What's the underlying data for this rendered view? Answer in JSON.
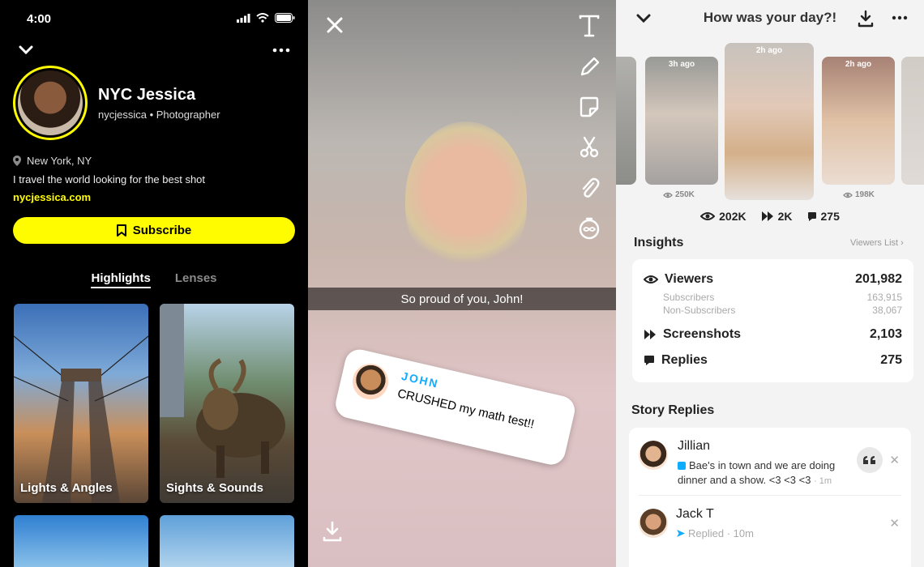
{
  "profile": {
    "time": "4:00",
    "name": "NYC Jessica",
    "handle": "nycjessica • Photographer",
    "location": "New York, NY",
    "bio": "I travel the world looking for the best shot",
    "link": "nycjessica.com",
    "subscribe_label": "Subscribe",
    "tabs": [
      "Highlights",
      "Lenses"
    ],
    "tiles": [
      "Lights & Angles",
      "Sights & Sounds"
    ],
    "accent": "#FFFC00"
  },
  "editor": {
    "caption": "So proud of you, John!",
    "sticker_name": "JOHN",
    "sticker_message": "CRUSHED my math test!!",
    "tools": [
      "text-icon",
      "pencil-icon",
      "sticker-icon",
      "scissors-icon",
      "paperclip-icon",
      "timer-icon"
    ]
  },
  "insights": {
    "title": "How was your day?!",
    "thumbnails": [
      {
        "ago": "3h ago",
        "views": "250K"
      },
      {
        "ago": "2h ago",
        "views": ""
      },
      {
        "ago": "2h ago",
        "views": "198K"
      }
    ],
    "summary": {
      "views": "202K",
      "screenshots": "2K",
      "replies": "275"
    },
    "section_title": "Insights",
    "viewers_list": "Viewers List",
    "viewers_label": "Viewers",
    "viewers": "201,982",
    "subscribers_label": "Subscribers",
    "subscribers": "163,915",
    "non_subscribers_label": "Non-Subscribers",
    "non_subscribers": "38,067",
    "screenshots_label": "Screenshots",
    "screenshots": "2,103",
    "replies_label": "Replies",
    "replies": "275",
    "story_replies_title": "Story Replies",
    "story_replies": [
      {
        "name": "Jillian",
        "message": "Bae's in town and we are doing dinner and a show. <3 <3 <3",
        "time": "1m"
      },
      {
        "name": "Jack T",
        "message": "Replied",
        "time": "10m"
      }
    ]
  }
}
